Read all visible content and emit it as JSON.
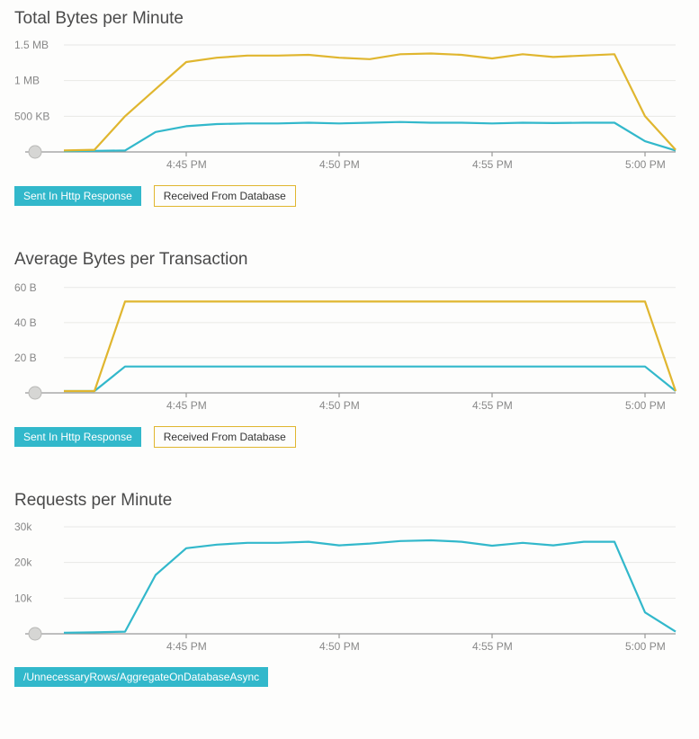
{
  "charts": [
    {
      "title": "Total Bytes per Minute",
      "legend": [
        {
          "label": "Sent In Http Response",
          "style": "cyan"
        },
        {
          "label": "Received From Database",
          "style": "gold-outline"
        }
      ]
    },
    {
      "title": "Average Bytes per Transaction",
      "legend": [
        {
          "label": "Sent In Http Response",
          "style": "cyan"
        },
        {
          "label": "Received From Database",
          "style": "gold-outline"
        }
      ]
    },
    {
      "title": "Requests per Minute",
      "legend": [
        {
          "label": "/UnnecessaryRows/AggregateOnDatabaseAsync",
          "style": "cyan-solid"
        }
      ]
    }
  ],
  "colors": {
    "cyan": "#32b8cb",
    "gold": "#e0b62f",
    "gridline": "#e8e8e6",
    "axis": "#999",
    "text": "#888"
  },
  "chart_data": [
    {
      "title": "Total Bytes per Minute",
      "type": "line",
      "xlabel": "",
      "ylabel": "",
      "x_ticks": [
        "4:45 PM",
        "4:50 PM",
        "4:55 PM",
        "5:00 PM"
      ],
      "y_ticks": [
        "500 KB",
        "1 MB",
        "1.5 MB"
      ],
      "ylim_bytes": [
        0,
        1600000
      ],
      "x_minutes": [
        41,
        42,
        43,
        44,
        45,
        46,
        47,
        48,
        49,
        50,
        51,
        52,
        53,
        54,
        55,
        56,
        57,
        58,
        59,
        60,
        61
      ],
      "series": [
        {
          "name": "Sent In Http Response",
          "color": "#32b8cb",
          "values_bytes": [
            10000,
            15000,
            20000,
            280000,
            360000,
            390000,
            400000,
            400000,
            410000,
            400000,
            410000,
            420000,
            410000,
            410000,
            400000,
            410000,
            405000,
            410000,
            410000,
            150000,
            20000
          ]
        },
        {
          "name": "Received From Database",
          "color": "#e0b62f",
          "values_bytes": [
            20000,
            30000,
            500000,
            880000,
            1260000,
            1320000,
            1350000,
            1350000,
            1360000,
            1320000,
            1300000,
            1370000,
            1380000,
            1360000,
            1310000,
            1370000,
            1330000,
            1350000,
            1370000,
            500000,
            30000
          ]
        }
      ]
    },
    {
      "title": "Average Bytes per Transaction",
      "type": "line",
      "xlabel": "",
      "ylabel": "",
      "x_ticks": [
        "4:45 PM",
        "4:50 PM",
        "4:55 PM",
        "5:00 PM"
      ],
      "y_ticks": [
        "20 B",
        "40 B",
        "60 B"
      ],
      "ylim": [
        0,
        65
      ],
      "x_minutes": [
        41,
        42,
        43,
        44,
        45,
        46,
        47,
        48,
        49,
        50,
        51,
        52,
        53,
        54,
        55,
        56,
        57,
        58,
        59,
        60,
        61
      ],
      "series": [
        {
          "name": "Sent In Http Response",
          "color": "#32b8cb",
          "values": [
            1,
            1,
            15,
            15,
            15,
            15,
            15,
            15,
            15,
            15,
            15,
            15,
            15,
            15,
            15,
            15,
            15,
            15,
            15,
            15,
            1
          ]
        },
        {
          "name": "Received From Database",
          "color": "#e0b62f",
          "values": [
            1,
            1,
            52,
            52,
            52,
            52,
            52,
            52,
            52,
            52,
            52,
            52,
            52,
            52,
            52,
            52,
            52,
            52,
            52,
            52,
            1
          ]
        }
      ]
    },
    {
      "title": "Requests per Minute",
      "type": "line",
      "xlabel": "",
      "ylabel": "",
      "x_ticks": [
        "4:45 PM",
        "4:50 PM",
        "4:55 PM",
        "5:00 PM"
      ],
      "y_ticks": [
        "10k",
        "20k",
        "30k"
      ],
      "ylim": [
        0,
        32000
      ],
      "x_minutes": [
        41,
        42,
        43,
        44,
        45,
        46,
        47,
        48,
        49,
        50,
        51,
        52,
        53,
        54,
        55,
        56,
        57,
        58,
        59,
        60,
        61
      ],
      "series": [
        {
          "name": "/UnnecessaryRows/AggregateOnDatabaseAsync",
          "color": "#32b8cb",
          "values": [
            300,
            400,
            600,
            16500,
            24000,
            25000,
            25500,
            25500,
            25800,
            24800,
            25300,
            26000,
            26200,
            25800,
            24700,
            25500,
            24800,
            25800,
            25800,
            6000,
            600
          ]
        }
      ]
    }
  ]
}
